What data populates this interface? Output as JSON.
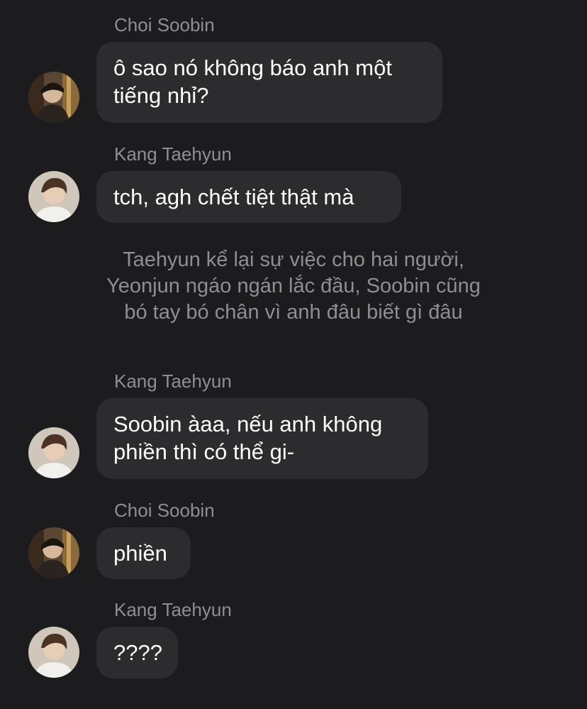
{
  "messages": [
    {
      "sender": "Choi Soobin",
      "text": "ô sao nó không báo anh một\ntiếng nhỉ?",
      "avatar": "soobin-avatar"
    },
    {
      "sender": "Kang Taehyun",
      "text": "tch, agh chết tiệt thật mà",
      "avatar": "taehyun-avatar"
    },
    {
      "sender": "Kang Taehyun",
      "text": "Soobin àaa, nếu anh không\nphiền thì có thể gi-",
      "avatar": "taehyun-avatar"
    },
    {
      "sender": "Choi Soobin",
      "text": "phiền",
      "avatar": "soobin-avatar"
    },
    {
      "sender": "Kang Taehyun",
      "text": "????",
      "avatar": "taehyun-avatar"
    }
  ],
  "narration": "Taehyun kể lại sự việc cho hai người,\nYeonjun ngáo ngán lắc đầu, Soobin cũng\nbó tay bó chân vì anh đâu biết gì đâu",
  "colors": {
    "background": "#1c1c1e",
    "bubble": "#2c2c2e",
    "sender_text": "#8e8e93",
    "message_text": "#ffffff"
  }
}
